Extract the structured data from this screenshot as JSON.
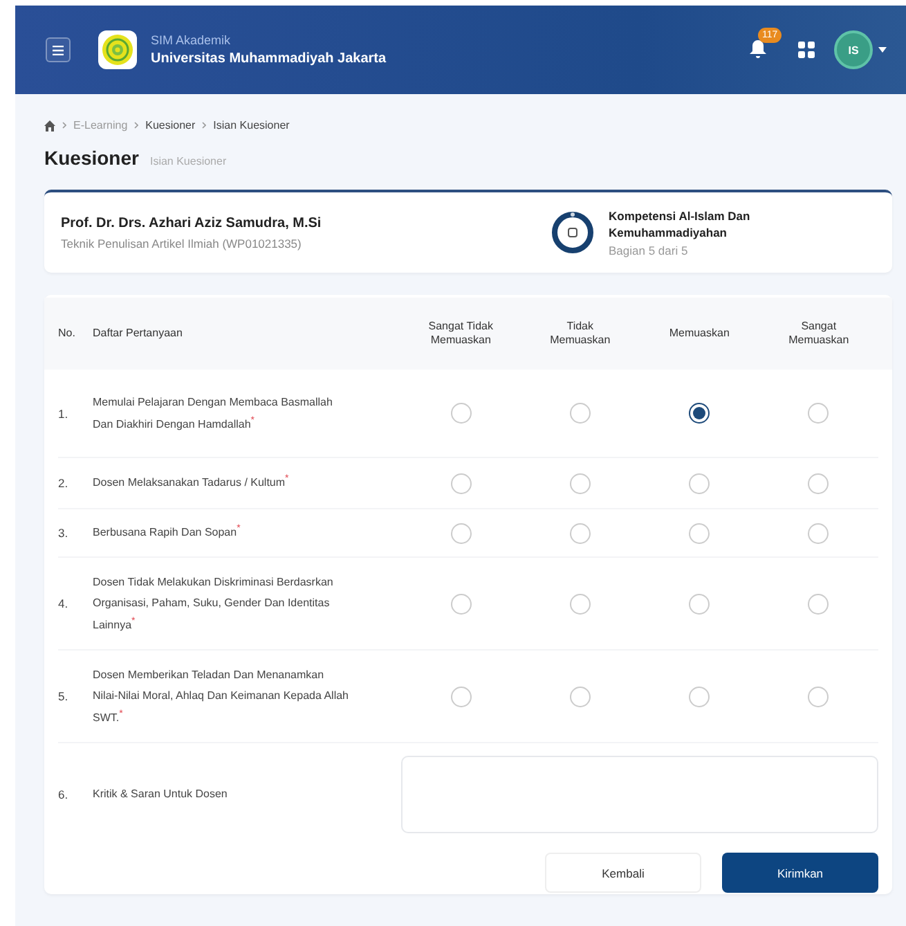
{
  "header": {
    "app_name": "SIM Akademik",
    "institution": "Universitas Muhammadiyah Jakarta",
    "notification_count": "117",
    "avatar_initials": "IS"
  },
  "breadcrumb": [
    "E-Learning",
    "Kuesioner",
    "Isian Kuesioner"
  ],
  "page_title": "Kuesioner",
  "page_subtitle": "Isian Kuesioner",
  "lecturer": {
    "name": "Prof. Dr. Drs. Azhari Aziz Samudra, M.Si",
    "course": "Teknik Penulisan Artikel Ilmiah (WP01021335)"
  },
  "section": {
    "title": "Kompetensi Al-Islam Dan Kemuhammadiyahan",
    "progress": "Bagian 5 dari 5",
    "level": 1
  },
  "table": {
    "columns": [
      "No.",
      "Daftar Pertanyaan",
      "Sangat Tidak Memuaskan",
      "Tidak Memuaskan",
      "Memuaskan",
      "Sangat Memuaskan"
    ],
    "rows": [
      {
        "kind": "rating",
        "no": "1.",
        "question": "Memulai Pelajaran Dengan Membaca Basmallah Dan Diakhiri Dengan Hamdallah$^{*}$",
        "options": [
          {
            "selected": false
          },
          {
            "selected": false
          },
          {
            "selected": true
          },
          {
            "selected": false
          }
        ]
      },
      {
        "kind": "rating",
        "no": "2.",
        "question": "Dosen Melaksanakan Tadarus / Kultum$^{*}$",
        "options": [
          {
            "selected": false
          },
          {
            "selected": false
          },
          {
            "selected": false
          },
          {
            "selected": false
          }
        ]
      },
      {
        "kind": "rating",
        "no": "3.",
        "question": "Berbusana Rapih Dan Sopan$^{*}$",
        "options": [
          {
            "selected": false
          },
          {
            "selected": false
          },
          {
            "selected": false
          },
          {
            "selected": false
          }
        ]
      },
      {
        "kind": "rating",
        "no": "4.",
        "question": "Dosen Tidak Melakukan Diskriminasi Berdasrkan Organisasi, Paham, Suku, Gender Dan Identitas Lainnya$^{*}$",
        "options": [
          {
            "selected": false
          },
          {
            "selected": false
          },
          {
            "selected": false
          },
          {
            "selected": false
          }
        ]
      },
      {
        "kind": "rating",
        "no": "5.",
        "question": "Dosen Memberikan Teladan Dan Menanamkan Nilai-Nilai Moral, Ahlaq Dan Keimanan Kepada Allah SWT.$^{*}$",
        "options": [
          {
            "selected": false
          },
          {
            "selected": false
          },
          {
            "selected": false
          },
          {
            "selected": false
          }
        ]
      },
      {
        "kind": "text",
        "no": "6.",
        "question": "Kritik & Saran Untuk Dosen"
      }
    ]
  },
  "buttons": [
    {
      "label": "Kembali",
      "kind": "secondary"
    },
    {
      "label": "Kirimkan",
      "kind": "primary"
    }
  ]
}
